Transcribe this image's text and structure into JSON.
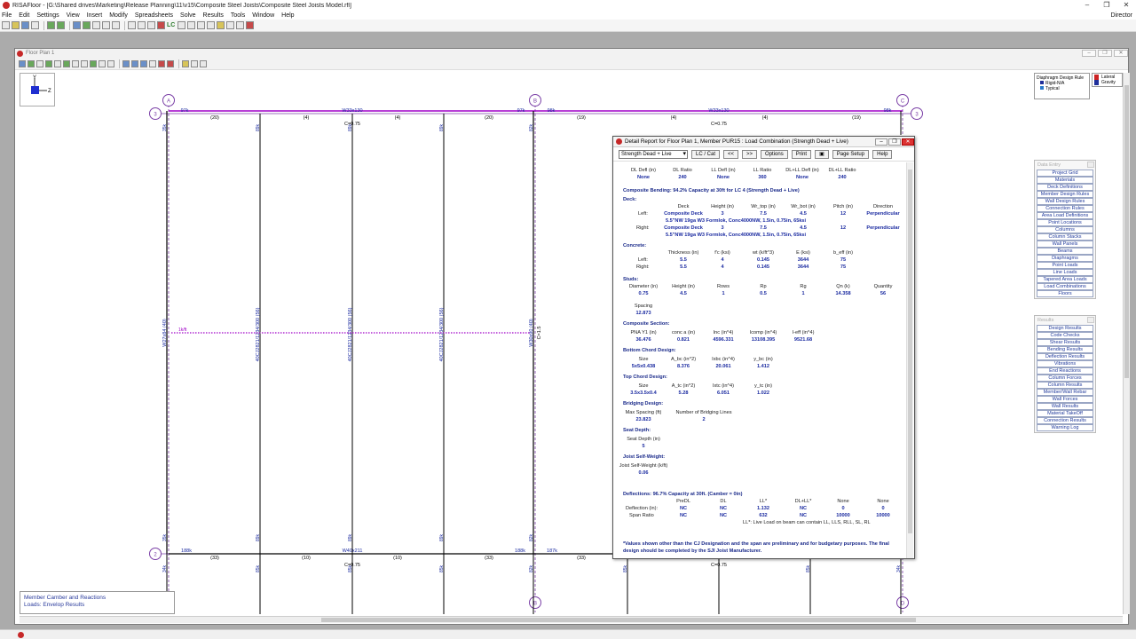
{
  "window": {
    "title": "RISAFloor - [G:\\Shared drives\\Marketing\\Release Planning\\11\\v15\\Composite Steel Joists\\Composite Steel Joists Model.rfl]",
    "controls": [
      "–",
      "❐",
      "✕"
    ]
  },
  "menu": [
    "File",
    "Edit",
    "Settings",
    "View",
    "Insert",
    "Modify",
    "Spreadsheets",
    "Solve",
    "Results",
    "Tools",
    "Window",
    "Help"
  ],
  "menu_right": "Director",
  "toolbar_lc": "LC",
  "floor_plan": {
    "title": "Floor Plan 1",
    "axes": {
      "y": "Y",
      "z": "Z"
    },
    "grid_top": [
      "A",
      "B",
      "C"
    ],
    "grid_left": [
      "3",
      "2"
    ],
    "grid_bottom": [
      "B",
      "D"
    ],
    "top_beam_left": {
      "label": "W33x130",
      "left_reaction": "97k",
      "right_reaction": "97k",
      "studs": [
        "(20)",
        "(4)",
        "(4)",
        "(20)"
      ]
    },
    "top_beam_right": {
      "label": "W33x130",
      "left_reaction": "98k",
      "right_reaction": "98k",
      "studs": [
        "(19)",
        "(4)",
        "(4)",
        "(19)"
      ],
      "camber": "C=0.75"
    },
    "top_camber": "C=0.75",
    "bottom_beam_left": {
      "label": "W40x211",
      "left_reaction": "188k",
      "right_reaction": "188k",
      "studs": [
        "(33)",
        "(10)",
        "(10)",
        "(33)"
      ],
      "camber": "C=0.75"
    },
    "bottom_beam_right": {
      "left_reaction": "187k",
      "studs": [
        "(33)"
      ],
      "camber": "C=0.75"
    },
    "joist_label": "40CJ2821/1234/300 (56)",
    "girder_label": "W27x84 (40)",
    "girder_label_right": "W30x90 (40)",
    "girder_camber_right": "C=1.5",
    "line_load": "1k/ft",
    "end_reactions_top": [
      "35k",
      "89k",
      "89k",
      "89k",
      "82k"
    ],
    "end_reactions_bottom": [
      "35k",
      "89k",
      "89k",
      "89k",
      "82k"
    ],
    "end_reactions_lower": [
      "34k",
      "85k",
      "85k",
      "85k",
      "82k",
      "85k",
      "85k",
      "34k"
    ]
  },
  "legend_box": {
    "line1": "Member Camber and Reactions",
    "line2": "Loads: Envelop Results"
  },
  "diaphragm_legend": {
    "title": "Diaphragm Design Rule",
    "items": [
      "Rigid-N/A",
      "Typical"
    ]
  },
  "gravity_legend": {
    "line1": "Lateral",
    "line2": "Gravity"
  },
  "data_entry": {
    "title": "Data Entry",
    "items": [
      "Project Grid",
      "Materials",
      "Deck Definitions",
      "Member Design Rules",
      "Wall Design Rules",
      "Connection Rules",
      "Area Load Definitions",
      "Point Locations",
      "Columns",
      "Column Stacks",
      "Wall Panels",
      "Beams",
      "Diaphragms",
      "Point Loads",
      "Line Loads",
      "Tapered Area Loads",
      "Load Combinations",
      "Floors"
    ]
  },
  "results": {
    "title": "Results",
    "items": [
      "Design Results",
      "Code Checks",
      "Shear Results",
      "Bending Results",
      "Deflection Results",
      "Vibrations",
      "End Reactions",
      "Column Forces",
      "Column Results",
      "Member/Wall Rebar",
      "Wall Forces",
      "Wall Results",
      "Material TakeOff",
      "Connection Results",
      "Warning Log"
    ]
  },
  "report": {
    "title": "Detail Report for Floor Plan 1, Member PUR15 : Load Combination (Strength Dead + Live)",
    "combo": "Strength Dead + Live",
    "buttons": [
      "LC / Cat",
      "<<",
      ">>",
      "Options",
      "Print",
      "▣",
      "Page Setup",
      "Help"
    ],
    "defl_header": [
      "DL Defl (in)",
      "DL Ratio",
      "LL Defl (in)",
      "LL Ratio",
      "DL+LL Defl (in)",
      "DL+LL Ratio"
    ],
    "defl_values": [
      "None",
      "240",
      "None",
      "360",
      "None",
      "240"
    ],
    "composite_bending": "Composite Bending: 94.2% Capacity at 30ft for LC  4 (Strength Dead + Live)",
    "deck": {
      "title": "Deck:",
      "header": [
        "Deck",
        "Height (in)",
        "Wr_top (in)",
        "Wr_bot (in)",
        "Pitch (in)",
        "Direction"
      ],
      "left_label": "Left:",
      "left": [
        "Composite Deck",
        "3",
        "7.5",
        "4.5",
        "12",
        "Perpendicular"
      ],
      "left_desc": "5.5\"NW 19ga W3 Formlok, Conc4000NW, 1.5in, 0.75in, 65ksi",
      "right_label": "Right:",
      "right": [
        "Composite Deck",
        "3",
        "7.5",
        "4.5",
        "12",
        "Perpendicular"
      ],
      "right_desc": "5.5\"NW 19ga W3 Formlok, Conc4000NW, 1.5in, 0.75in, 65ksi"
    },
    "concrete": {
      "title": "Concrete:",
      "header": [
        "Thickness (in)",
        "f'c (ksi)",
        "wt (k/ft^3)",
        "E (ksi)",
        "b_eff (in)"
      ],
      "left_label": "Left:",
      "left": [
        "5.5",
        "4",
        "0.145",
        "3644",
        "75"
      ],
      "right_label": "Right:",
      "right": [
        "5.5",
        "4",
        "0.145",
        "3644",
        "75"
      ]
    },
    "studs": {
      "title": "Studs:",
      "header": [
        "Diameter (in)",
        "Height (in)",
        "Rows",
        "Rp",
        "Rg",
        "Qn (k)",
        "Quantity"
      ],
      "values": [
        "0.75",
        "4.5",
        "1",
        "0.5",
        "1",
        "14.358",
        "56"
      ],
      "spacing_label": "Spacing",
      "spacing": "12.873"
    },
    "composite_section": {
      "title": "Composite Section:",
      "header": [
        "PNA Y1 (in)",
        "conc a (in)",
        "Inc (in^4)",
        "Icomp (in^4)",
        "I-eff (in^4)"
      ],
      "values": [
        "36.476",
        "0.821",
        "4596.331",
        "13108.395",
        "9521.68"
      ]
    },
    "bottom_chord": {
      "title": "Bottom Chord Design:",
      "header": [
        "Size",
        "A_bc (in^2)",
        "Ixbc (in^4)",
        "y_bc (in)"
      ],
      "values": [
        "5x5x0.438",
        "8.376",
        "20.061",
        "1.412"
      ]
    },
    "top_chord": {
      "title": "Top Chord Design:",
      "header": [
        "Size",
        "A_tc (in^2)",
        "Ixtc (in^4)",
        "y_tc (in)"
      ],
      "values": [
        "3.5x3.5x0.4",
        "5.28",
        "6.051",
        "1.022"
      ]
    },
    "bridging": {
      "title": "Bridging Design:",
      "header": [
        "Max Spacing (ft)",
        "Number of Bridging Lines"
      ],
      "values": [
        "23.823",
        "2"
      ]
    },
    "seat_depth": {
      "title": "Seat Depth:",
      "header": "Seat Depth (in)",
      "value": "5"
    },
    "self_weight": {
      "title": "Joist Self-Weight:",
      "header": "Joist Self-Weight (k/ft)",
      "value": "0.06"
    },
    "deflections": {
      "title": "Deflections: 96.7% Capacity at 30ft.  (Camber = 0in)",
      "header": [
        "PreDL",
        "DL",
        "LL*",
        "DL+LL*",
        "None",
        "None"
      ],
      "row1_label": "Deflection (in):",
      "row1": [
        "NC",
        "NC",
        "1.132",
        "NC",
        "0",
        "0"
      ],
      "row2_label": "Span Ratio",
      "row2": [
        "NC",
        "NC",
        "632",
        "NC",
        "10000",
        "10000"
      ],
      "note": "LL*: Live Load on beam can contain LL, LLS, RLL, SL, RL"
    },
    "footer": "*Values shown other than the CJ Designation and the span are preliminary and for budgetary purposes. The final design should be completed by the SJI Joist Manufacturer."
  },
  "colors": {
    "beam": "#000000",
    "label": "#1a2aa0",
    "grid": "#7a3fa6",
    "highlight": "#a000c8"
  }
}
